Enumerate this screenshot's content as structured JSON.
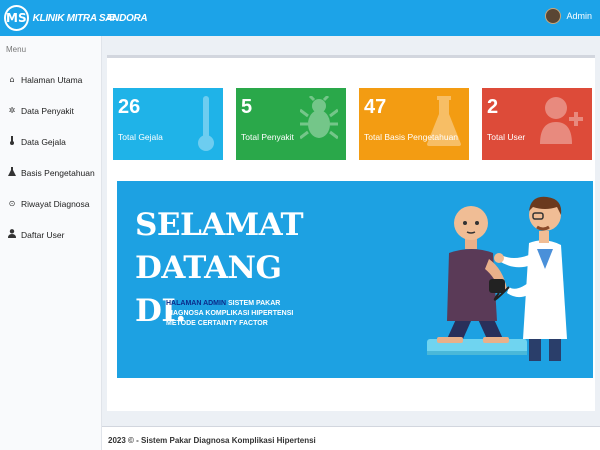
{
  "header": {
    "logo_badge": "MS",
    "logo_text": "KLINIK MITRA SANDORA",
    "menu_toggle": "≡",
    "user_name": "Admin"
  },
  "sidebar": {
    "header": "Menu",
    "items": [
      {
        "label": "Halaman Utama",
        "icon": "home-icon",
        "glyph": "⌂"
      },
      {
        "label": "Data Penyakit",
        "icon": "bug-icon",
        "glyph": "✲"
      },
      {
        "label": "Data Gejala",
        "icon": "thermometer-icon",
        "glyph": "🌡"
      },
      {
        "label": "Basis Pengetahuan",
        "icon": "flask-icon",
        "glyph": "⚗"
      },
      {
        "label": "Riwayat Diagnosa",
        "icon": "history-icon",
        "glyph": "⊙"
      },
      {
        "label": "Daftar User",
        "icon": "user-icon",
        "glyph": "●"
      }
    ]
  },
  "stats": [
    {
      "value": "26",
      "label": "Total Gejala",
      "color": "#1fb3e8",
      "icon": "thermometer-icon"
    },
    {
      "value": "5",
      "label": "Total Penyakit",
      "color": "#2aa84a",
      "icon": "bug-icon"
    },
    {
      "value": "47",
      "label": "Total Basis Pengetahuan",
      "color": "#f39c12",
      "icon": "flask-icon"
    },
    {
      "value": "2",
      "label": "Total User",
      "color": "#dd4b39",
      "icon": "user-plus-icon"
    }
  ],
  "banner": {
    "line1": "SELAMAT",
    "line2": "DATANG",
    "line3": "DI.",
    "desc_highlight": "HALAMAN ADMIN",
    "desc_line1": " SISTEM PAKAR",
    "desc_line2": "DIAGNOSA KOMPLIKASI HIPERTENSI",
    "desc_line3": "METODE CERTAINTY FACTOR",
    "color": "#1da1e2"
  },
  "footer": {
    "text": "2023 © - Sistem Pakar Diagnosa Komplikasi Hipertensi"
  }
}
